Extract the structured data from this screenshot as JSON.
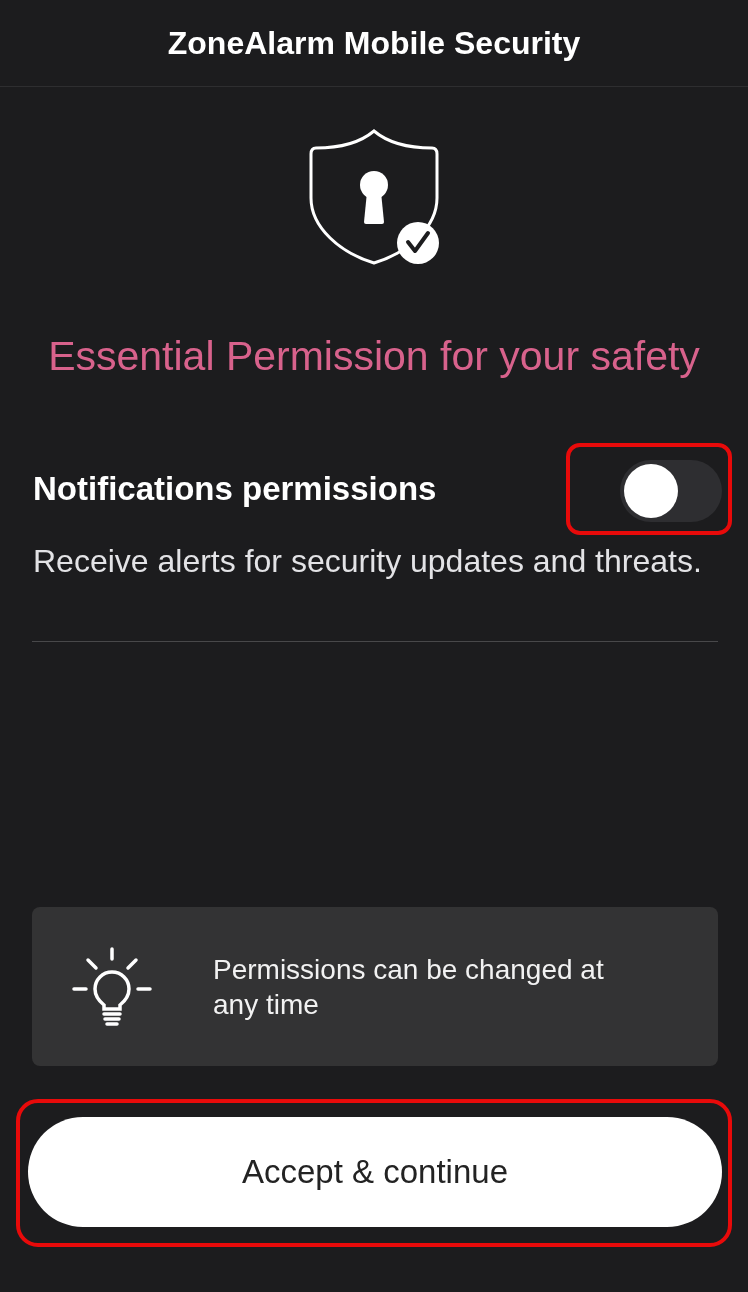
{
  "header": {
    "title": "ZoneAlarm Mobile Security"
  },
  "heading": "Essential Permission for your safety",
  "permissions": [
    {
      "title": "Notifications permissions",
      "description": "Receive alerts for security updates and threats.",
      "on": false,
      "highlighted": true
    }
  ],
  "info_card": {
    "text": "Permissions can be changed at any time"
  },
  "primary_button": {
    "label": "Accept & continue",
    "highlighted": true
  }
}
